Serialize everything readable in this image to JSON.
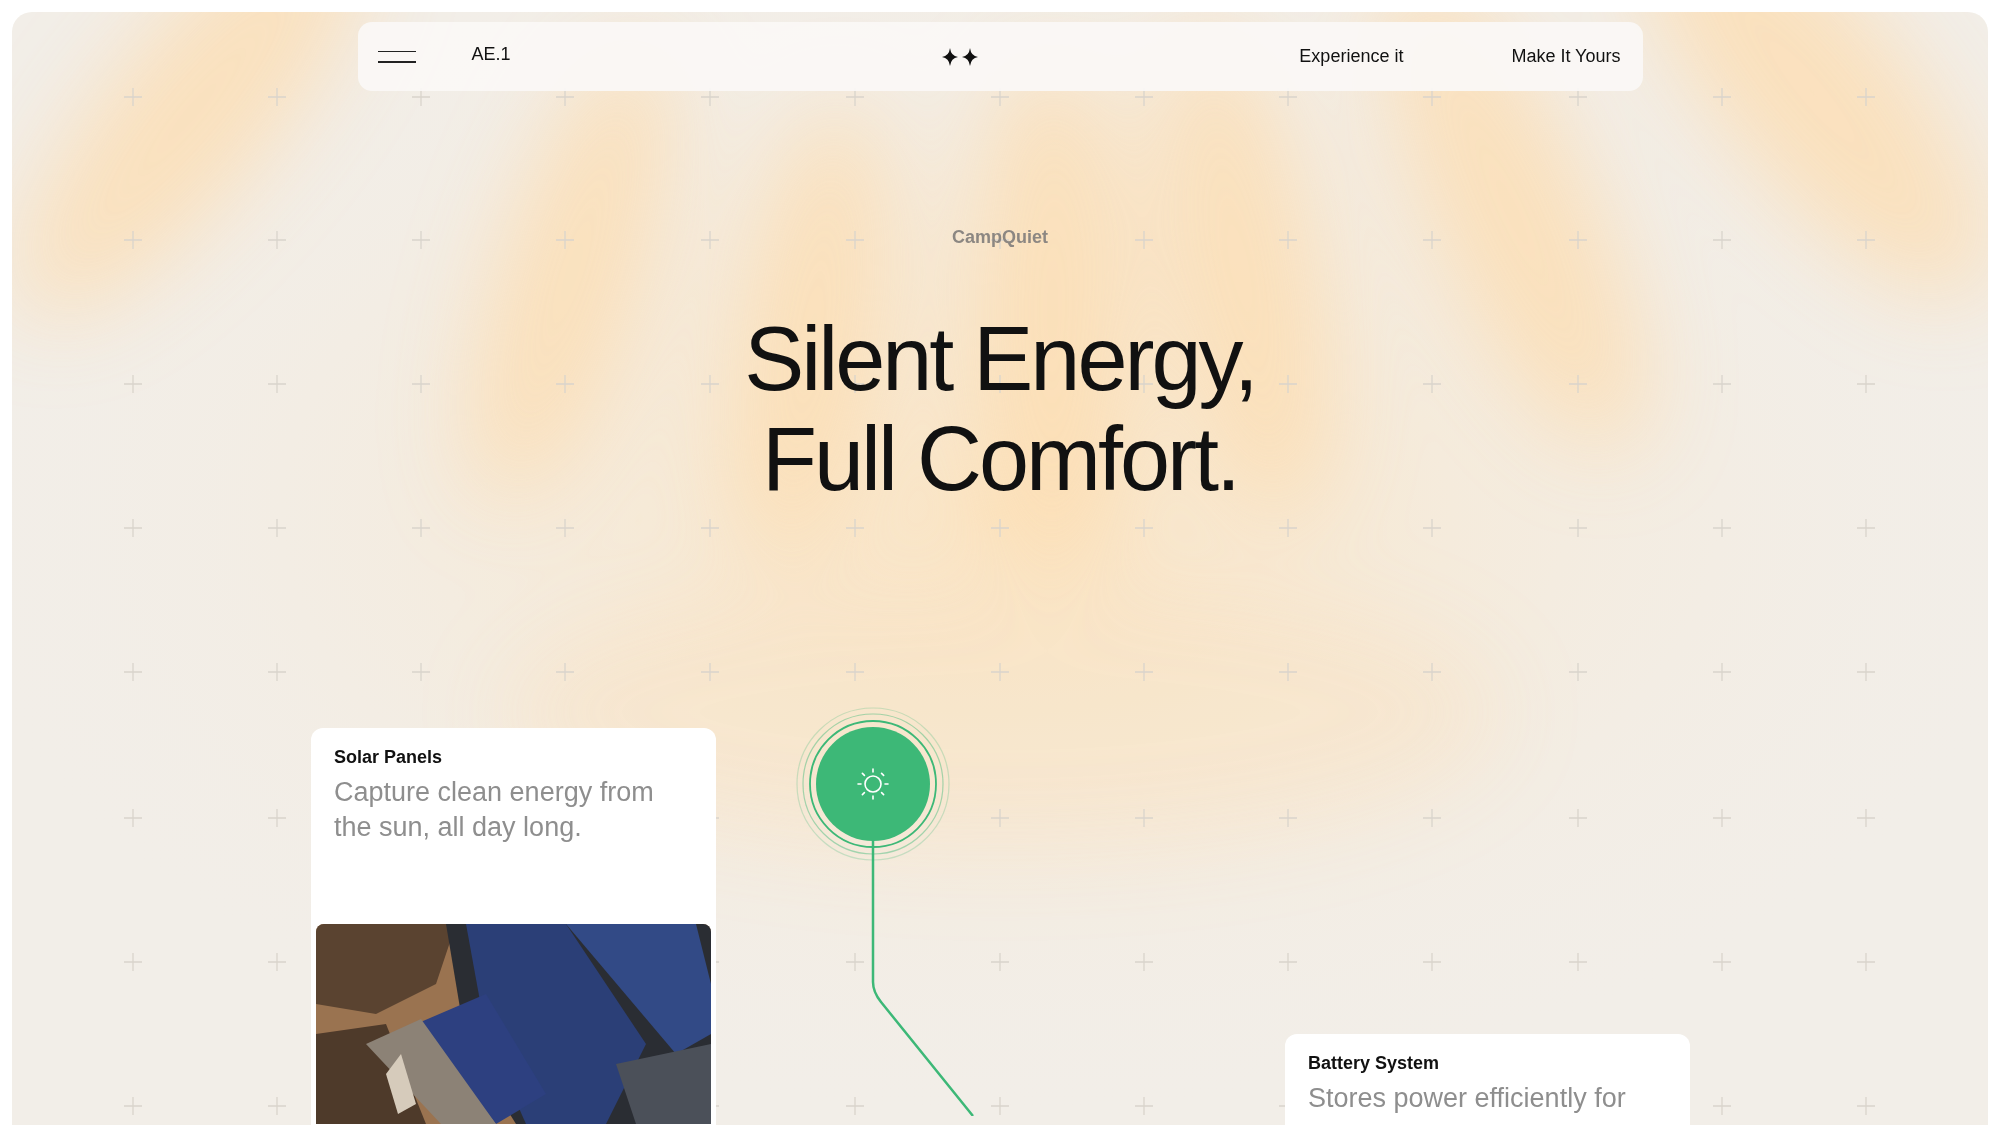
{
  "nav": {
    "brand": "AE.1",
    "links": [
      {
        "label": "Experience it"
      },
      {
        "label": "Make It Yours"
      }
    ]
  },
  "hero": {
    "eyebrow": "CampQuiet",
    "headline": [
      "Silent Energy,",
      "Full Comfort."
    ]
  },
  "features": [
    {
      "title": "Solar Panels",
      "description": "Capture clean energy from the sun, all day long."
    },
    {
      "title": "Battery System",
      "description": "Stores power efficiently for"
    }
  ]
}
